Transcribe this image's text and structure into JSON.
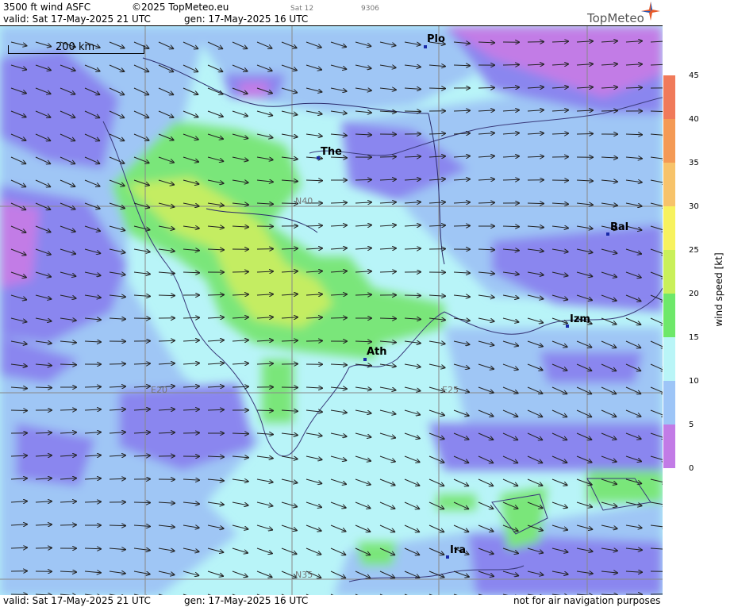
{
  "header": {
    "title": "3500 ft wind ASFC",
    "copyright": "©2025 TopMeteo.eu",
    "valid": "valid:  Sat  17-May-2025  21 UTC",
    "gen": "gen: 17-May-2025 16 UTC",
    "tab_label": "Sat 12",
    "code": "9306",
    "logo": "TopMeteo"
  },
  "map": {
    "scale_label": "200 km",
    "grid_labels": {
      "n40": "N40",
      "n35": "N35",
      "e20": "E20",
      "e25": "E25"
    },
    "cities": [
      {
        "id": "plo",
        "label": "Plo"
      },
      {
        "id": "the",
        "label": "The"
      },
      {
        "id": "bal",
        "label": "Bal"
      },
      {
        "id": "izm",
        "label": "Izm"
      },
      {
        "id": "ath",
        "label": "Ath"
      },
      {
        "id": "ira",
        "label": "Ira"
      }
    ]
  },
  "colorbar": {
    "title": "wind  speed  [kt]",
    "ticks": [
      "45",
      "40",
      "35",
      "30",
      "25",
      "20",
      "15",
      "10",
      "5",
      "0"
    ],
    "colors": [
      "#f07a5a",
      "#f49a55",
      "#f7c36a",
      "#f7f25e",
      "#c9f05a",
      "#6ee86a",
      "#b9f5f7",
      "#9dc5f7",
      "#8a87f0",
      "#c27be6"
    ]
  },
  "footer": {
    "valid": "valid:  Sat  17-May-2025  21 UTC",
    "gen": "gen: 17-May-2025 16 UTC",
    "note": "not for air navigation purposes"
  }
}
